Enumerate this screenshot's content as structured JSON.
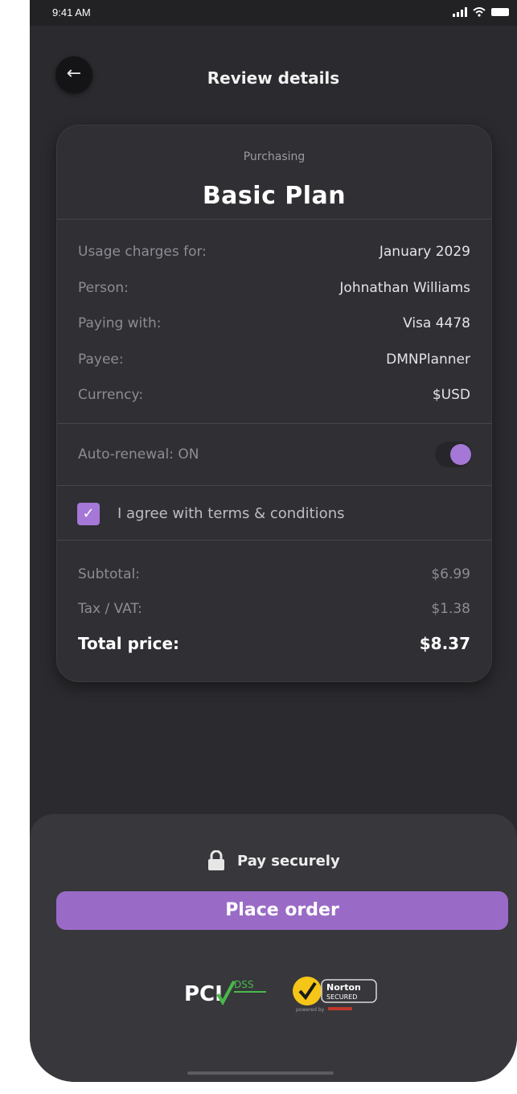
{
  "status_bar": {
    "time": "9:41 AM"
  },
  "header": {
    "title": "Review details",
    "back_icon": "arrow-left-icon"
  },
  "summary": {
    "purchasing_label": "Purchasing",
    "plan_name": "Basic Plan",
    "details": [
      {
        "label": "Usage charges for:",
        "value": "January 2029"
      },
      {
        "label": "Person:",
        "value": "Johnathan Williams"
      },
      {
        "label": "Paying with:",
        "value": "Visa 4478"
      },
      {
        "label": "Payee:",
        "value": "DMNPlanner"
      },
      {
        "label": "Currency:",
        "value": "$USD"
      }
    ],
    "auto_renewal_label": "Auto-renewal: ON",
    "auto_renewal_on": true,
    "terms_label": "I agree with terms & conditions",
    "terms_checked": true,
    "subtotal": {
      "label": "Subtotal:",
      "value": "$6.99"
    },
    "tax": {
      "label": "Tax / VAT:",
      "value": "$1.38"
    },
    "total": {
      "label": "Total price:",
      "value": "$8.37"
    }
  },
  "footer": {
    "pay_securely_label": "Pay securely",
    "place_order_label": "Place order",
    "badges": {
      "pci": {
        "main": "PCI",
        "sub": "DSS"
      },
      "norton": {
        "main": "Norton",
        "sub": "SECURED",
        "powered_by": "powered by"
      }
    }
  },
  "colors": {
    "accent": "#a577d6",
    "button": "#9a6bc6",
    "background": "#2b2b2f",
    "card": "#2f2f34"
  }
}
